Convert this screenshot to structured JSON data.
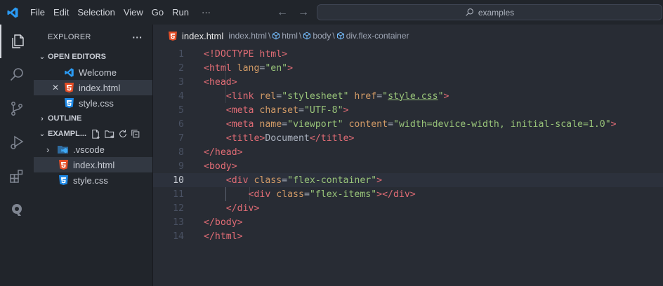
{
  "titlebar": {
    "menu": [
      "File",
      "Edit",
      "Selection",
      "View",
      "Go",
      "Run",
      "···"
    ],
    "search_text": "examples"
  },
  "activity_bar": {
    "icons": [
      "explorer-icon",
      "search-icon",
      "source-control-icon",
      "run-debug-icon",
      "extensions-icon",
      "remote-icon"
    ]
  },
  "sidebar": {
    "title": "EXPLORER",
    "more_actions": "···",
    "open_editors": {
      "label": "OPEN EDITORS",
      "items": [
        {
          "name": "Welcome",
          "icon": "vscode-icon"
        },
        {
          "name": "index.html",
          "icon": "html5-icon",
          "close": "✕"
        },
        {
          "name": "style.css",
          "icon": "css3-icon"
        }
      ]
    },
    "outline_label": "OUTLINE",
    "workspace": {
      "label": "EXAMPL...",
      "items": [
        {
          "name": ".vscode",
          "icon": "vscode-folder-icon"
        },
        {
          "name": "index.html",
          "icon": "html5-icon"
        },
        {
          "name": "style.css",
          "icon": "css3-icon"
        }
      ]
    }
  },
  "editor": {
    "breadcrumb": {
      "file": "index.html",
      "path": [
        "index.html",
        "html",
        "body",
        "div.flex-container"
      ],
      "separator": "\\"
    },
    "current_line": 10,
    "line_numbers": [
      "1",
      "2",
      "3",
      "4",
      "5",
      "6",
      "7",
      "8",
      "9",
      "10",
      "11",
      "12",
      "13",
      "14"
    ],
    "lines": [
      [
        {
          "t": "tag",
          "v": "<!DOCTYPE html>"
        }
      ],
      [
        {
          "t": "tag",
          "v": "<html "
        },
        {
          "t": "attr",
          "v": "lang"
        },
        {
          "t": "txt",
          "v": "="
        },
        {
          "t": "str",
          "v": "\"en\""
        },
        {
          "t": "tag",
          "v": ">"
        }
      ],
      [
        {
          "t": "tag",
          "v": "<head>"
        }
      ],
      [
        {
          "t": "txt",
          "v": "    "
        },
        {
          "t": "tag",
          "v": "<link "
        },
        {
          "t": "attr",
          "v": "rel"
        },
        {
          "t": "txt",
          "v": "="
        },
        {
          "t": "str",
          "v": "\"stylesheet\""
        },
        {
          "t": "txt",
          "v": " "
        },
        {
          "t": "attr",
          "v": "href"
        },
        {
          "t": "txt",
          "v": "="
        },
        {
          "t": "str",
          "v": "\""
        },
        {
          "t": "str ul",
          "v": "style.css"
        },
        {
          "t": "str",
          "v": "\""
        },
        {
          "t": "tag",
          "v": ">"
        }
      ],
      [
        {
          "t": "txt",
          "v": "    "
        },
        {
          "t": "tag",
          "v": "<meta "
        },
        {
          "t": "attr",
          "v": "charset"
        },
        {
          "t": "txt",
          "v": "="
        },
        {
          "t": "str",
          "v": "\"UTF-8\""
        },
        {
          "t": "tag",
          "v": ">"
        }
      ],
      [
        {
          "t": "txt",
          "v": "    "
        },
        {
          "t": "tag",
          "v": "<meta "
        },
        {
          "t": "attr",
          "v": "name"
        },
        {
          "t": "txt",
          "v": "="
        },
        {
          "t": "str",
          "v": "\"viewport\""
        },
        {
          "t": "txt",
          "v": " "
        },
        {
          "t": "attr",
          "v": "content"
        },
        {
          "t": "txt",
          "v": "="
        },
        {
          "t": "str",
          "v": "\"width=device-width, initial-scale=1.0\""
        },
        {
          "t": "tag",
          "v": ">"
        }
      ],
      [
        {
          "t": "txt",
          "v": "    "
        },
        {
          "t": "tag",
          "v": "<title>"
        },
        {
          "t": "txt",
          "v": "Document"
        },
        {
          "t": "tag",
          "v": "</title>"
        }
      ],
      [
        {
          "t": "tag",
          "v": "</head>"
        }
      ],
      [
        {
          "t": "tag",
          "v": "<body>"
        }
      ],
      [
        {
          "t": "txt",
          "v": "    "
        },
        {
          "t": "tag",
          "v": "<div "
        },
        {
          "t": "attr",
          "v": "class"
        },
        {
          "t": "txt",
          "v": "="
        },
        {
          "t": "str",
          "v": "\"flex-container\""
        },
        {
          "t": "tag",
          "v": ">"
        }
      ],
      [
        {
          "t": "txt",
          "v": "        "
        },
        {
          "t": "tag",
          "v": "<div "
        },
        {
          "t": "attr",
          "v": "class"
        },
        {
          "t": "txt",
          "v": "="
        },
        {
          "t": "str",
          "v": "\"flex-items\""
        },
        {
          "t": "tag",
          "v": "></div>"
        }
      ],
      [
        {
          "t": "txt",
          "v": "    "
        },
        {
          "t": "tag",
          "v": "</div>"
        }
      ],
      [
        {
          "t": "tag",
          "v": "</body>"
        }
      ],
      [
        {
          "t": "tag",
          "v": "</html>"
        }
      ]
    ]
  },
  "colors": {
    "tag": "#e06c75",
    "attr": "#d19a66",
    "string": "#98c379",
    "accent": "#0098ff",
    "html_icon": "#e44d26",
    "css_icon": "#1e88e5"
  }
}
